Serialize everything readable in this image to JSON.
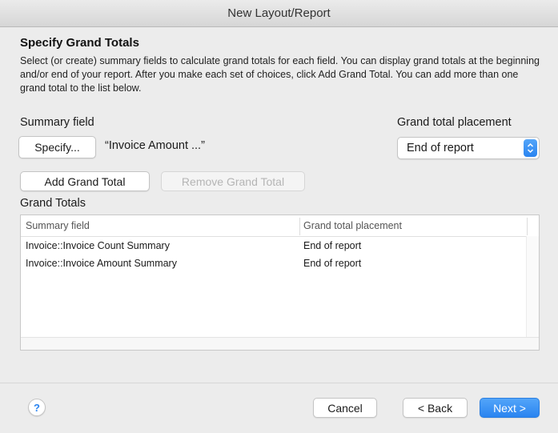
{
  "window": {
    "title": "New Layout/Report"
  },
  "section": {
    "heading": "Specify Grand Totals",
    "description": "Select (or create) summary fields to calculate grand totals for each field. You can display grand totals at the beginning and/or end of your report. After you make each set of choices, click Add Grand Total. You can add more than one grand total to the list below."
  },
  "summary_field": {
    "label": "Summary field",
    "specify_label": "Specify...",
    "value": "“Invoice Amount ...”"
  },
  "placement": {
    "label": "Grand total placement",
    "selected": "End of report"
  },
  "actions": {
    "add_label": "Add Grand Total",
    "remove_label": "Remove Grand Total"
  },
  "grand_totals": {
    "label": "Grand Totals",
    "columns": [
      "Summary field",
      "Grand total placement"
    ],
    "rows": [
      {
        "field": "Invoice::Invoice Count Summary",
        "placement": "End of report"
      },
      {
        "field": "Invoice::Invoice Amount Summary",
        "placement": "End of report"
      }
    ]
  },
  "footer": {
    "help": "?",
    "cancel_label": "Cancel",
    "back_label": "< Back",
    "next_label": "Next >"
  },
  "colors": {
    "accent": "#2a84f0",
    "background": "#ececec"
  }
}
